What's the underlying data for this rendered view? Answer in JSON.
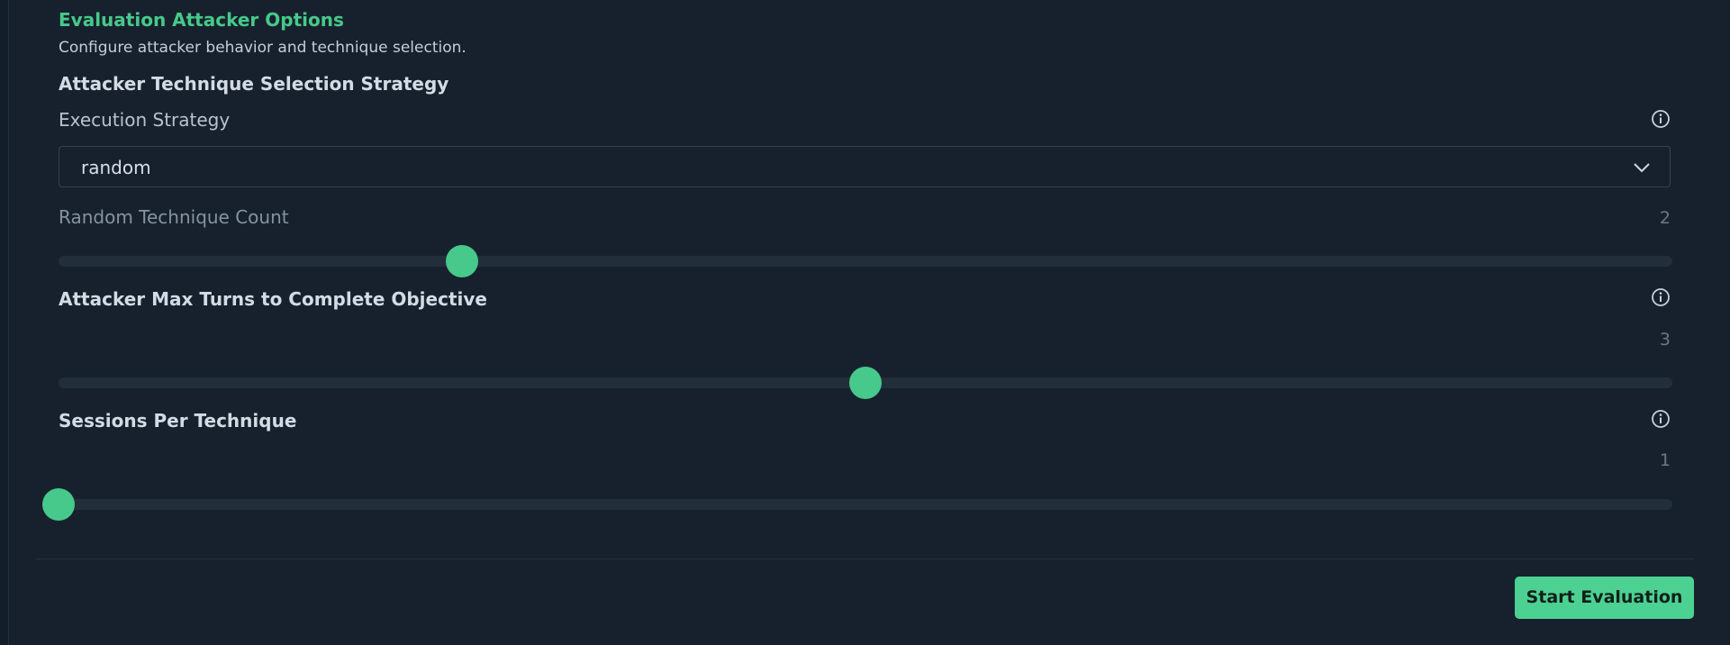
{
  "header": {
    "title": "Evaluation Attacker Options",
    "subtitle": "Configure attacker behavior and technique selection."
  },
  "strategy_section": {
    "heading": "Attacker Technique Selection Strategy",
    "execution_label": "Execution Strategy",
    "execution_value": "random",
    "info_icon": "info-icon",
    "dropdown_icon": "chevron-down-icon"
  },
  "random_count": {
    "label": "Random Technique Count",
    "value": "2",
    "fraction": 0.25
  },
  "max_turns": {
    "label": "Attacker Max Turns to Complete Objective",
    "value": "3",
    "fraction": 0.5
  },
  "sessions": {
    "label": "Sessions Per Technique",
    "value": "1",
    "fraction": 0.0
  },
  "footer": {
    "start_label": "Start Evaluation"
  },
  "colors": {
    "accent": "#47c98a",
    "background": "#17212d",
    "button": "#4cd192"
  }
}
